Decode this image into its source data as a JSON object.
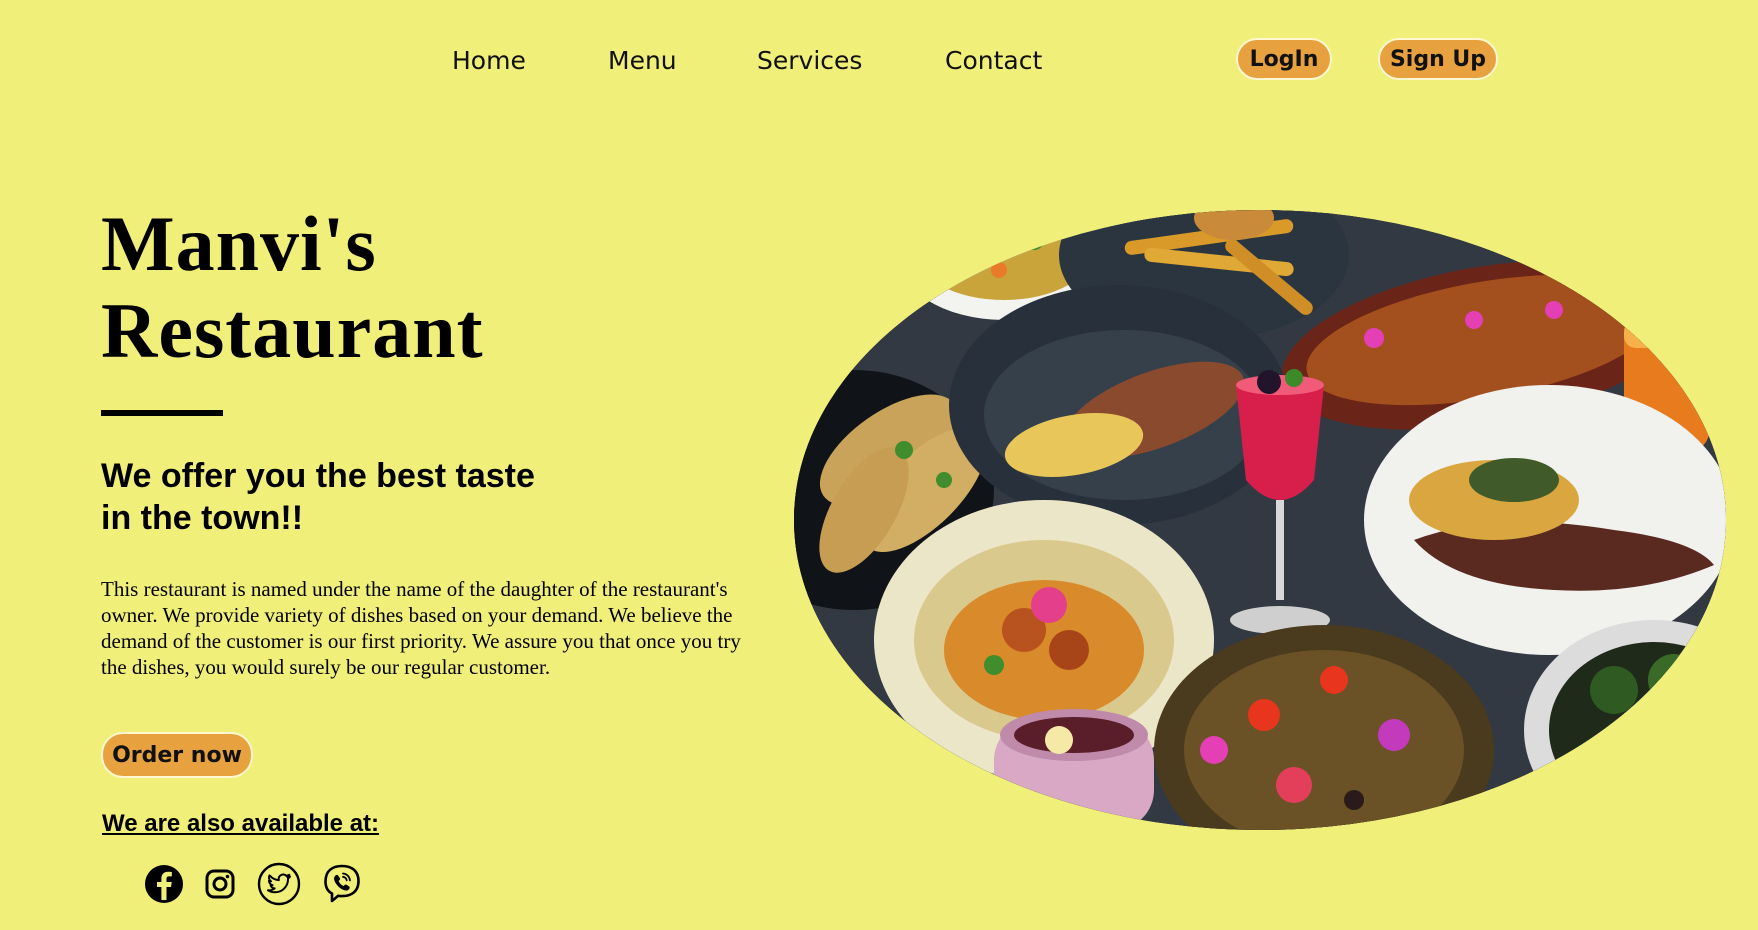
{
  "nav": {
    "links": [
      "Home",
      "Menu",
      "Services",
      "Contact"
    ],
    "login_label": "LogIn",
    "signup_label": "Sign Up"
  },
  "hero": {
    "title_line1": "Manvi's",
    "title_line2": "Restaurant",
    "tagline_line1": "We offer you the best taste",
    "tagline_line2": "in the town!!",
    "description": "This restaurant is named under the name of the daughter of the restaurant's owner. We provide variety of dishes based on your demand. We believe the demand of the customer is our first priority. We assure you that once you try the dishes, you would surely be our regular customer.",
    "order_label": "Order now",
    "available_label": "We are also available at:"
  },
  "social_icons": [
    "facebook-icon",
    "instagram-icon",
    "twitter-icon",
    "viber-icon"
  ],
  "colors": {
    "background": "#f0ef7a",
    "button": "#e8a13f",
    "text": "#000000"
  }
}
